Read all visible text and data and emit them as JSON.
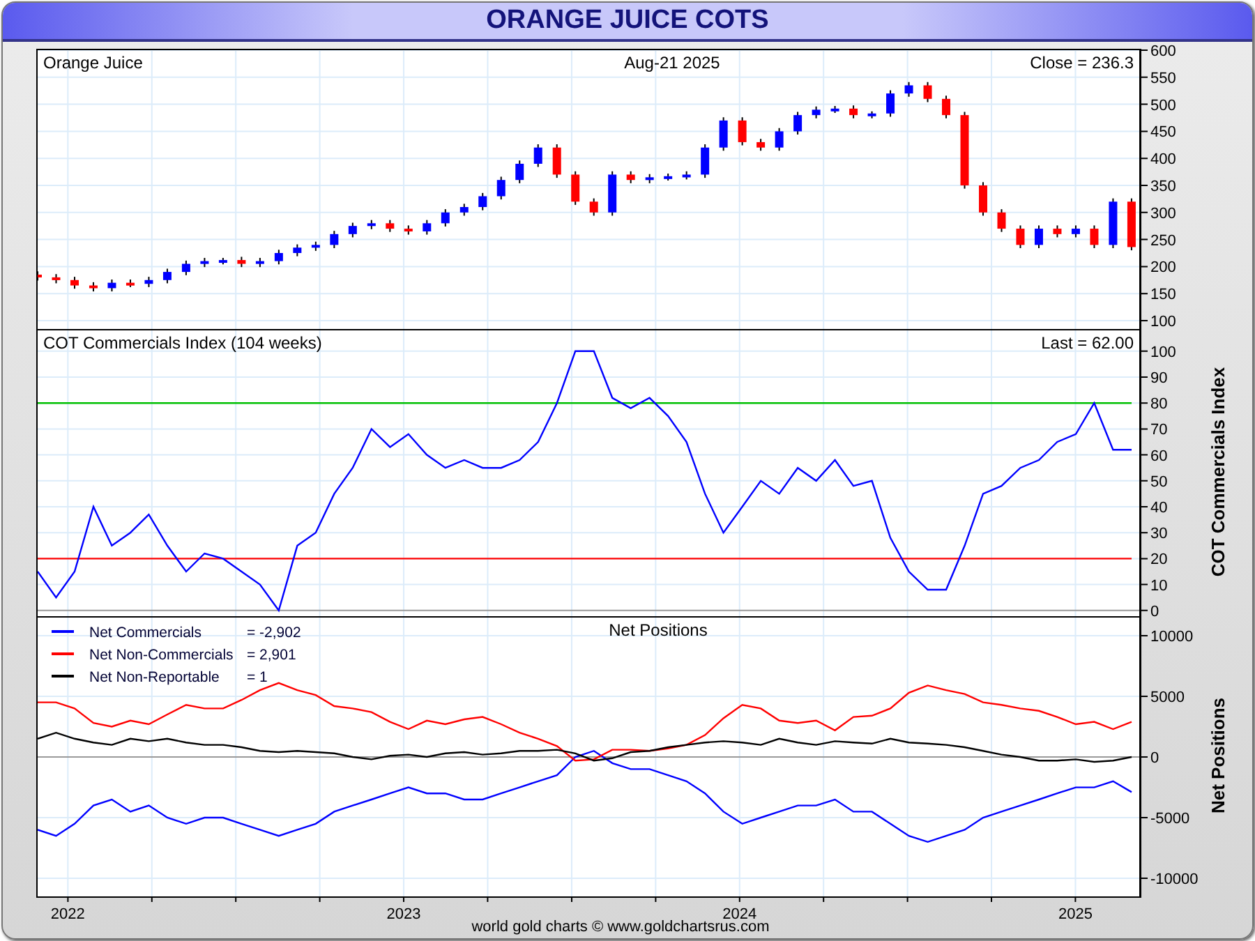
{
  "window": {
    "title": "ORANGE JUICE COTS"
  },
  "panels": [
    {
      "date": "Aug-21  2025",
      "reading": "Close = 236.3",
      "chart_data": {
        "type": "candlestick",
        "title": "Orange Juice",
        "grid": true,
        "x": [
          2021.91,
          2021.965,
          2022.02,
          2022.076,
          2022.131,
          2022.186,
          2022.241,
          2022.296,
          2022.352,
          2022.407,
          2022.462,
          2022.517,
          2022.572,
          2022.628,
          2022.683,
          2022.738,
          2022.793,
          2022.848,
          2022.904,
          2022.959,
          2023.014,
          2023.069,
          2023.124,
          2023.18,
          2023.235,
          2023.29,
          2023.345,
          2023.4,
          2023.456,
          2023.511,
          2023.566,
          2023.621,
          2023.676,
          2023.732,
          2023.787,
          2023.842,
          2023.897,
          2023.952,
          2024.008,
          2024.063,
          2024.118,
          2024.173,
          2024.228,
          2024.284,
          2024.339,
          2024.394,
          2024.449,
          2024.504,
          2024.56,
          2024.615,
          2024.67,
          2024.725,
          2024.78,
          2024.836,
          2024.891,
          2024.946,
          2025.001,
          2025.056,
          2025.112,
          2025.167
        ],
        "ohlc": [
          [
            185,
            191,
            174,
            180
          ],
          [
            180,
            186,
            169,
            175
          ],
          [
            175,
            181,
            159,
            165
          ],
          [
            165,
            171,
            154,
            160
          ],
          [
            160,
            176,
            154,
            170
          ],
          [
            170,
            176,
            162,
            168
          ],
          [
            168,
            181,
            162,
            175
          ],
          [
            175,
            196,
            169,
            190
          ],
          [
            190,
            211,
            184,
            205
          ],
          [
            205,
            216,
            199,
            210
          ],
          [
            210,
            216,
            204,
            212
          ],
          [
            212,
            218,
            199,
            205
          ],
          [
            205,
            216,
            199,
            210
          ],
          [
            210,
            231,
            204,
            225
          ],
          [
            225,
            241,
            219,
            235
          ],
          [
            235,
            246,
            229,
            240
          ],
          [
            240,
            266,
            234,
            260
          ],
          [
            260,
            281,
            254,
            275
          ],
          [
            275,
            286,
            269,
            280
          ],
          [
            280,
            286,
            264,
            270
          ],
          [
            270,
            276,
            259,
            265
          ],
          [
            265,
            286,
            259,
            280
          ],
          [
            280,
            306,
            274,
            300
          ],
          [
            300,
            316,
            294,
            310
          ],
          [
            310,
            336,
            304,
            330
          ],
          [
            330,
            366,
            324,
            360
          ],
          [
            360,
            396,
            354,
            390
          ],
          [
            390,
            426,
            384,
            420
          ],
          [
            420,
            426,
            364,
            370
          ],
          [
            370,
            376,
            314,
            320
          ],
          [
            320,
            326,
            294,
            300
          ],
          [
            300,
            376,
            294,
            370
          ],
          [
            370,
            376,
            354,
            360
          ],
          [
            360,
            371,
            354,
            365
          ],
          [
            365,
            372,
            359,
            367
          ],
          [
            367,
            376,
            361,
            370
          ],
          [
            370,
            426,
            364,
            420
          ],
          [
            420,
            476,
            414,
            470
          ],
          [
            470,
            476,
            424,
            430
          ],
          [
            430,
            436,
            414,
            420
          ],
          [
            420,
            456,
            414,
            450
          ],
          [
            450,
            486,
            444,
            480
          ],
          [
            480,
            496,
            474,
            490
          ],
          [
            490,
            497,
            484,
            492
          ],
          [
            492,
            498,
            474,
            480
          ],
          [
            480,
            487,
            474,
            483
          ],
          [
            483,
            526,
            477,
            520
          ],
          [
            520,
            541,
            514,
            535
          ],
          [
            535,
            541,
            504,
            510
          ],
          [
            510,
            516,
            474,
            480
          ],
          [
            480,
            486,
            344,
            350
          ],
          [
            350,
            356,
            294,
            300
          ],
          [
            300,
            306,
            264,
            270
          ],
          [
            270,
            276,
            234,
            240
          ],
          [
            240,
            276,
            234,
            270
          ],
          [
            270,
            276,
            254,
            260
          ],
          [
            260,
            276,
            254,
            270
          ],
          [
            270,
            276,
            234,
            240
          ],
          [
            240,
            326,
            234,
            320
          ],
          [
            320,
            326,
            230,
            236
          ]
        ],
        "xlim": [
          2021.91,
          2025.19
        ],
        "ylim": [
          84.5,
          600
        ],
        "yticks": [
          100,
          150,
          200,
          250,
          300,
          350,
          400,
          450,
          500,
          550,
          600
        ]
      }
    },
    {
      "reading": "Last = 62.00",
      "chart_data": {
        "type": "line",
        "title": "COT Commercials Index (104 weeks)",
        "ylabel": "COT Commercials Index",
        "grid": true,
        "x": [
          2021.91,
          2021.965,
          2022.02,
          2022.076,
          2022.131,
          2022.186,
          2022.241,
          2022.296,
          2022.352,
          2022.407,
          2022.462,
          2022.517,
          2022.572,
          2022.628,
          2022.683,
          2022.738,
          2022.793,
          2022.848,
          2022.904,
          2022.959,
          2023.014,
          2023.069,
          2023.124,
          2023.18,
          2023.235,
          2023.29,
          2023.345,
          2023.4,
          2023.456,
          2023.511,
          2023.566,
          2023.621,
          2023.676,
          2023.732,
          2023.787,
          2023.842,
          2023.897,
          2023.952,
          2024.008,
          2024.063,
          2024.118,
          2024.173,
          2024.228,
          2024.284,
          2024.339,
          2024.394,
          2024.449,
          2024.504,
          2024.56,
          2024.615,
          2024.67,
          2024.725,
          2024.78,
          2024.836,
          2024.891,
          2024.946,
          2025.001,
          2025.056,
          2025.112,
          2025.167
        ],
        "series": [
          {
            "color": "#00c000",
            "values": [
              80,
              80,
              80,
              80,
              80,
              80,
              80,
              80,
              80,
              80,
              80,
              80,
              80,
              80,
              80,
              80,
              80,
              80,
              80,
              80,
              80,
              80,
              80,
              80,
              80,
              80,
              80,
              80,
              80,
              80,
              80,
              80,
              80,
              80,
              80,
              80,
              80,
              80,
              80,
              80,
              80,
              80,
              80,
              80,
              80,
              80,
              80,
              80,
              80,
              80,
              80,
              80,
              80,
              80,
              80,
              80,
              80,
              80,
              80,
              80
            ]
          },
          {
            "color": "#ff0000",
            "values": [
              20,
              20,
              20,
              20,
              20,
              20,
              20,
              20,
              20,
              20,
              20,
              20,
              20,
              20,
              20,
              20,
              20,
              20,
              20,
              20,
              20,
              20,
              20,
              20,
              20,
              20,
              20,
              20,
              20,
              20,
              20,
              20,
              20,
              20,
              20,
              20,
              20,
              20,
              20,
              20,
              20,
              20,
              20,
              20,
              20,
              20,
              20,
              20,
              20,
              20,
              20,
              20,
              20,
              20,
              20,
              20,
              20,
              20,
              20,
              20
            ]
          },
          {
            "color": "#0000ff",
            "values": [
              15,
              5,
              15,
              40,
              25,
              30,
              37,
              25,
              15,
              22,
              20,
              15,
              10,
              0,
              25,
              30,
              45,
              55,
              70,
              63,
              68,
              60,
              55,
              58,
              55,
              55,
              58,
              65,
              80,
              100,
              100,
              82,
              78,
              82,
              75,
              65,
              45,
              30,
              40,
              50,
              45,
              55,
              50,
              58,
              48,
              50,
              28,
              15,
              8,
              8,
              25,
              45,
              48,
              55,
              58,
              65,
              68,
              80,
              62,
              62
            ]
          }
        ],
        "xlim": [
          2021.91,
          2025.19
        ],
        "ylim": [
          -2.2,
          108
        ],
        "yticks": [
          0,
          10,
          20,
          30,
          40,
          50,
          60,
          70,
          80,
          90,
          100
        ]
      }
    },
    {
      "legend_values": [
        "= -2,902",
        "= 2,901",
        "= 1"
      ],
      "chart_data": {
        "type": "line",
        "title": "Net Positions",
        "ylabel": "Net Positions",
        "grid": true,
        "legend": true,
        "x": [
          2021.91,
          2021.965,
          2022.02,
          2022.076,
          2022.131,
          2022.186,
          2022.241,
          2022.296,
          2022.352,
          2022.407,
          2022.462,
          2022.517,
          2022.572,
          2022.628,
          2022.683,
          2022.738,
          2022.793,
          2022.848,
          2022.904,
          2022.959,
          2023.014,
          2023.069,
          2023.124,
          2023.18,
          2023.235,
          2023.29,
          2023.345,
          2023.4,
          2023.456,
          2023.511,
          2023.566,
          2023.621,
          2023.676,
          2023.732,
          2023.787,
          2023.842,
          2023.897,
          2023.952,
          2024.008,
          2024.063,
          2024.118,
          2024.173,
          2024.228,
          2024.284,
          2024.339,
          2024.394,
          2024.449,
          2024.504,
          2024.56,
          2024.615,
          2024.67,
          2024.725,
          2024.78,
          2024.836,
          2024.891,
          2024.946,
          2025.001,
          2025.056,
          2025.112,
          2025.167
        ],
        "series": [
          {
            "name": "Net Commercials",
            "color": "#0000ff",
            "values": [
              -6000,
              -6500,
              -5500,
              -4000,
              -3500,
              -4500,
              -4000,
              -5000,
              -5500,
              -5000,
              -5000,
              -5500,
              -6000,
              -6500,
              -6000,
              -5500,
              -4500,
              -4000,
              -3500,
              -3000,
              -2500,
              -3000,
              -3000,
              -3500,
              -3500,
              -3000,
              -2500,
              -2000,
              -1500,
              0,
              500,
              -500,
              -1000,
              -1000,
              -1500,
              -2000,
              -3000,
              -4500,
              -5500,
              -5000,
              -4500,
              -4000,
              -4000,
              -3500,
              -4500,
              -4500,
              -5500,
              -6500,
              -7000,
              -6500,
              -6000,
              -5000,
              -4500,
              -4000,
              -3500,
              -3000,
              -2500,
              -2500,
              -2000,
              -2900
            ]
          },
          {
            "name": "Net Non-Commercials",
            "color": "#ff0000",
            "values": [
              4500,
              4500,
              4000,
              2800,
              2500,
              3000,
              2700,
              3500,
              4300,
              4000,
              4000,
              4700,
              5500,
              6100,
              5500,
              5100,
              4200,
              4000,
              3700,
              2900,
              2300,
              3000,
              2700,
              3100,
              3300,
              2700,
              2000,
              1500,
              900,
              -300,
              -200,
              600,
              600,
              500,
              700,
              1000,
              1800,
              3200,
              4300,
              4000,
              3000,
              2800,
              3000,
              2200,
              3300,
              3400,
              4000,
              5300,
              5900,
              5500,
              5200,
              4500,
              4300,
              4000,
              3800,
              3300,
              2700,
              2900,
              2300,
              2900
            ]
          },
          {
            "name": "Net Non-Reportable",
            "color": "#000000",
            "values": [
              1500,
              2000,
              1500,
              1200,
              1000,
              1500,
              1300,
              1500,
              1200,
              1000,
              1000,
              800,
              500,
              400,
              500,
              400,
              300,
              0,
              -200,
              100,
              200,
              0,
              300,
              400,
              200,
              300,
              500,
              500,
              600,
              300,
              -300,
              -100,
              400,
              500,
              800,
              1000,
              1200,
              1300,
              1200,
              1000,
              1500,
              1200,
              1000,
              1300,
              1200,
              1100,
              1500,
              1200,
              1100,
              1000,
              800,
              500,
              200,
              0,
              -300,
              -300,
              -200,
              -400,
              -300,
              0
            ]
          }
        ],
        "xlim": [
          2021.91,
          2025.19
        ],
        "ylim": [
          -11494,
          11494
        ],
        "yticks": [
          -10000,
          -5000,
          0,
          5000,
          10000
        ],
        "xticks": [
          {
            "value": 2022,
            "label": "2022"
          },
          {
            "value": 2023,
            "label": "2023"
          },
          {
            "value": 2024,
            "label": "2024"
          },
          {
            "value": 2025,
            "label": "2025"
          }
        ]
      }
    }
  ],
  "credit": "world gold charts © www.goldchartsrus.com"
}
